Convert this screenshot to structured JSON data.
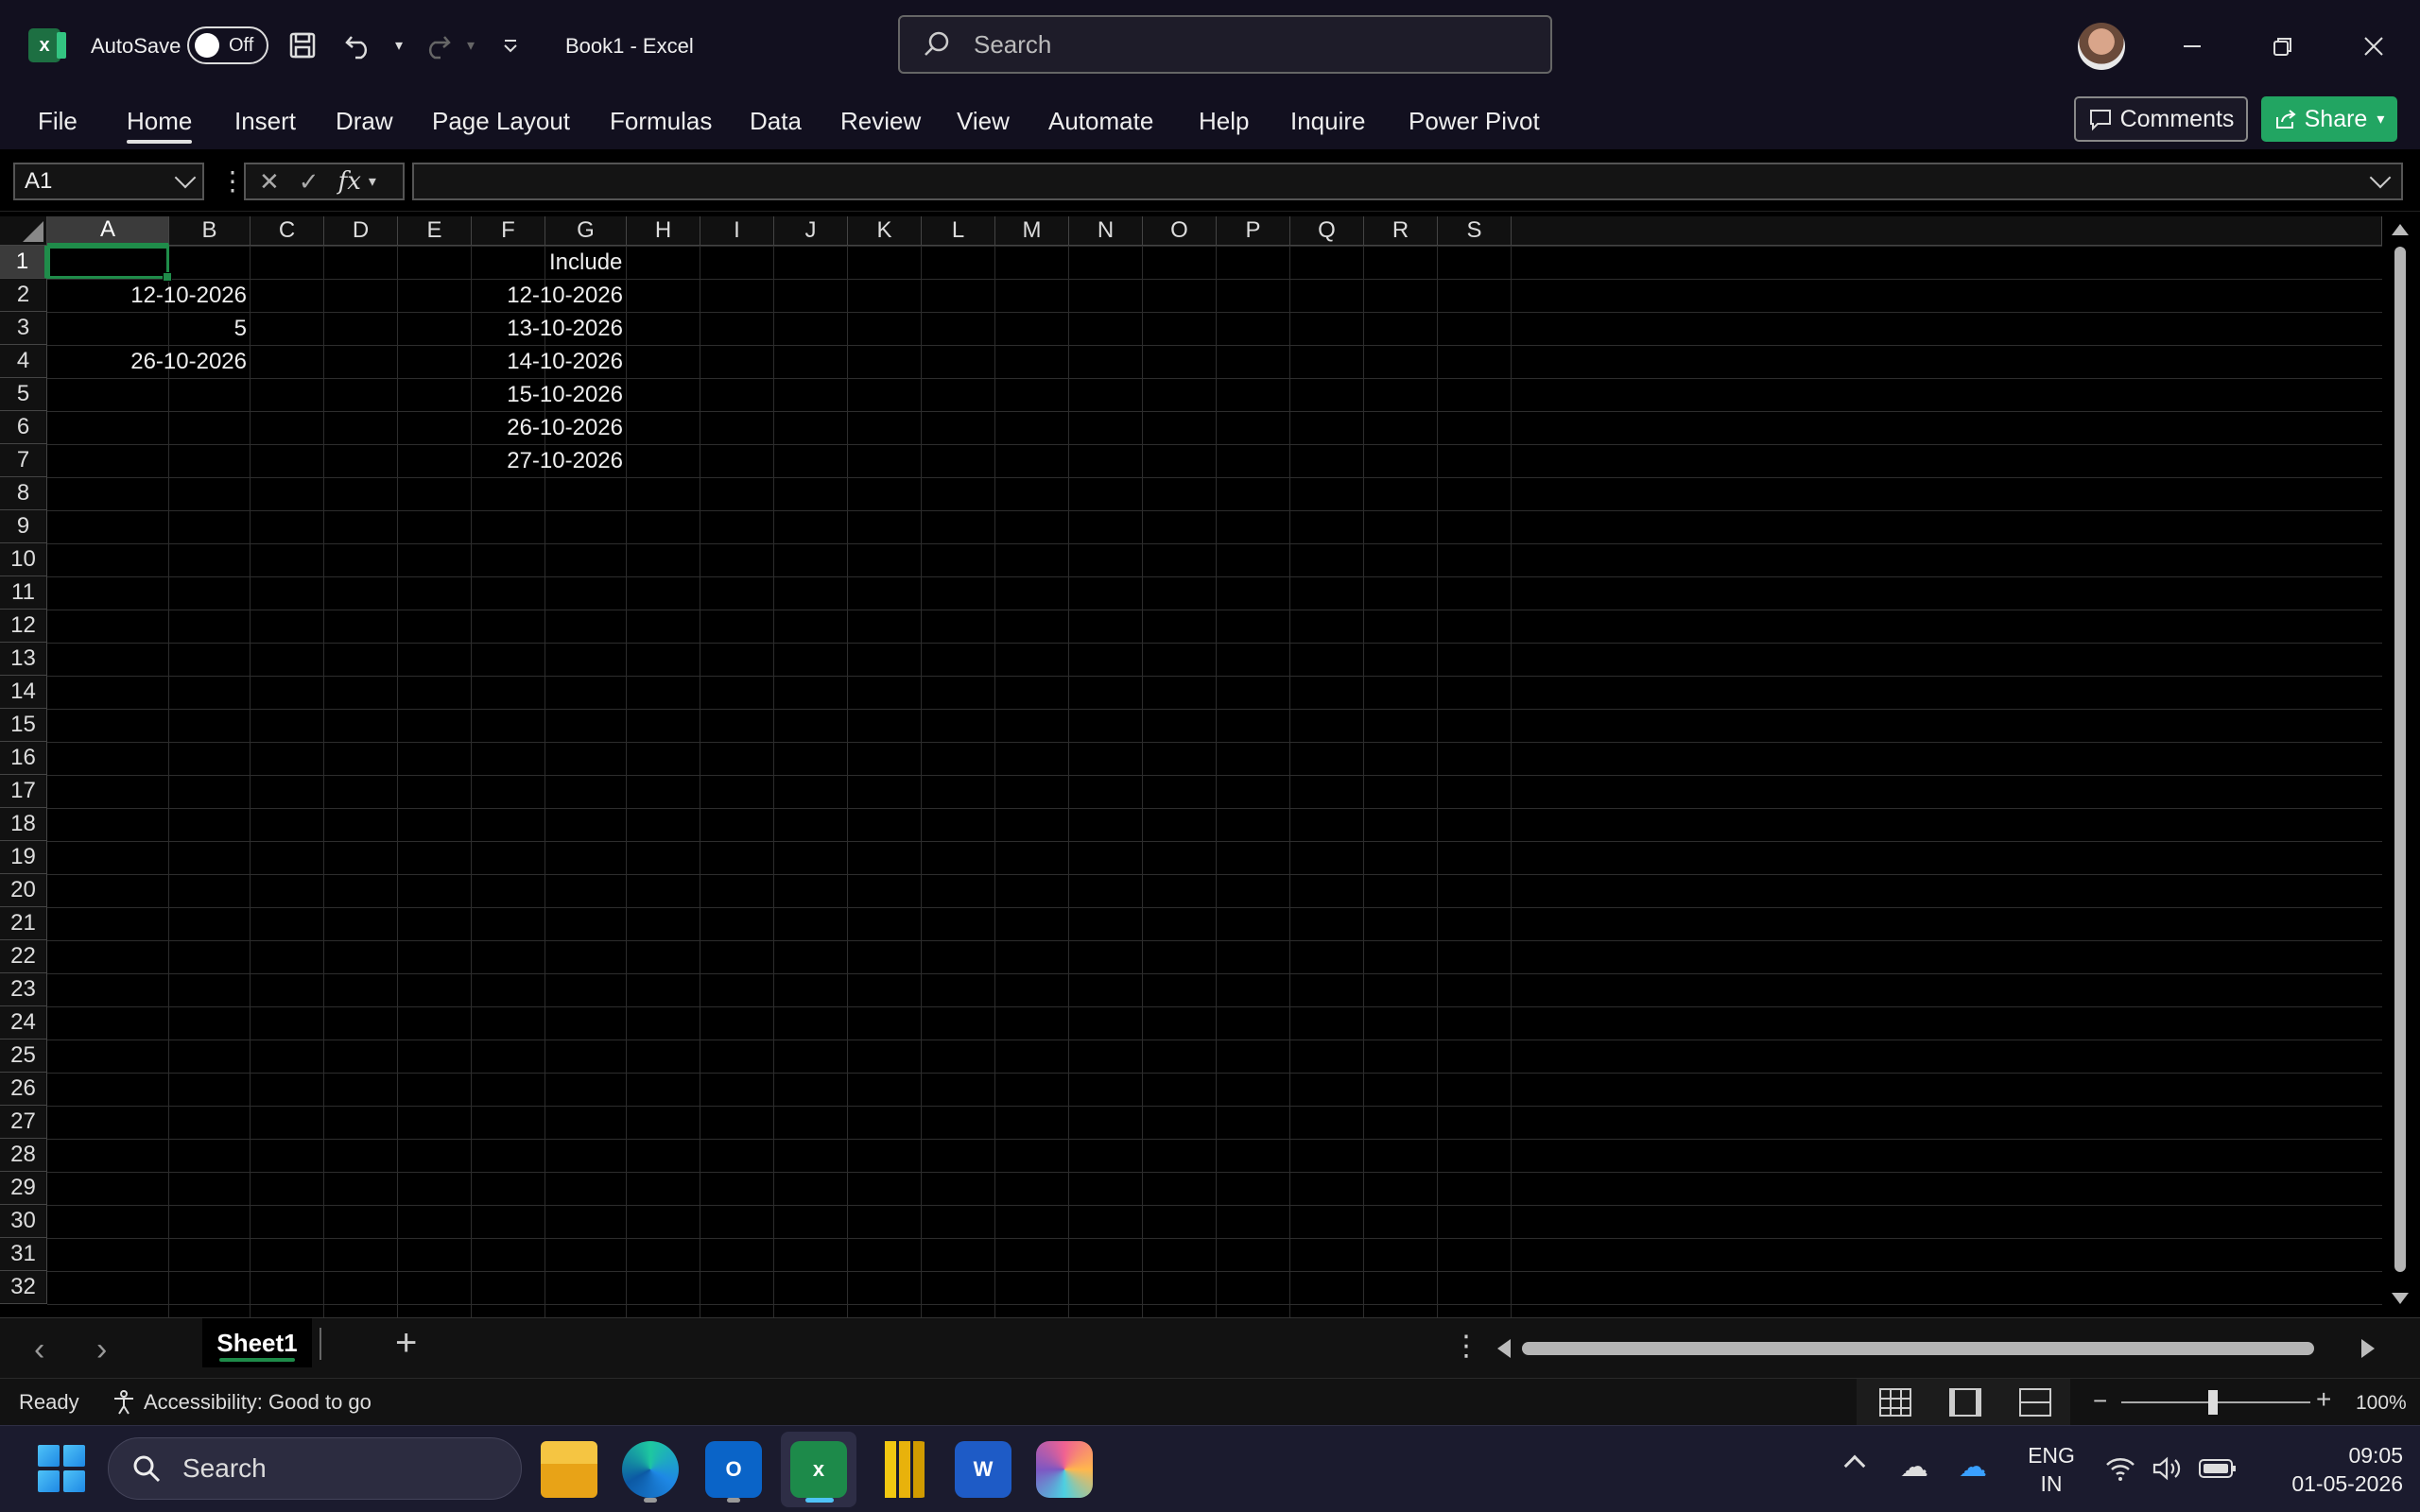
{
  "window": {
    "autosave_label": "AutoSave",
    "autosave_state": "Off",
    "file_title": "Book1  -  Excel",
    "search_placeholder": "Search",
    "accent_color": "#1f8c4a"
  },
  "ribbon": {
    "tabs": [
      "File",
      "Home",
      "Insert",
      "Draw",
      "Page Layout",
      "Formulas",
      "Data",
      "Review",
      "View",
      "Automate",
      "Help",
      "Inquire",
      "Power Pivot"
    ],
    "active_tab": "Home",
    "comments_label": "Comments",
    "share_label": "Share"
  },
  "formula_bar": {
    "name_box": "A1",
    "fx_label": "fx",
    "formula": ""
  },
  "sheet": {
    "columns": [
      "A",
      "B",
      "C",
      "D",
      "E",
      "F",
      "G",
      "H",
      "I",
      "J",
      "K",
      "L",
      "M",
      "N",
      "O",
      "P",
      "Q",
      "R",
      "S"
    ],
    "rows": [
      "1",
      "2",
      "3",
      "4",
      "5",
      "6",
      "7",
      "8",
      "9",
      "10",
      "11",
      "12",
      "13",
      "14",
      "15",
      "16",
      "17",
      "18",
      "19",
      "20",
      "21",
      "22",
      "23",
      "24",
      "25",
      "26",
      "27",
      "28",
      "29",
      "30",
      "31",
      "32"
    ],
    "selected_cell": "A1",
    "cells": {
      "B2": "12-10-2026",
      "B3": "5",
      "B4": "26-10-2026",
      "G1": "Include",
      "G2": "12-10-2026",
      "G3": "13-10-2026",
      "G4": "14-10-2026",
      "G5": "15-10-2026",
      "G6": "26-10-2026",
      "G7": "27-10-2026"
    }
  },
  "sheet_tabs": {
    "tabs": [
      "Sheet1"
    ],
    "active": "Sheet1"
  },
  "status_bar": {
    "status": "Ready",
    "accessibility": "Accessibility: Good to go",
    "zoom": "100%"
  },
  "taskbar": {
    "search_placeholder": "Search",
    "apps": [
      "file-explorer",
      "edge",
      "outlook",
      "excel",
      "power-bi",
      "word",
      "copilot"
    ],
    "lang_line1": "ENG",
    "lang_line2": "IN",
    "time": "09:05",
    "date": "01-05-2026"
  }
}
